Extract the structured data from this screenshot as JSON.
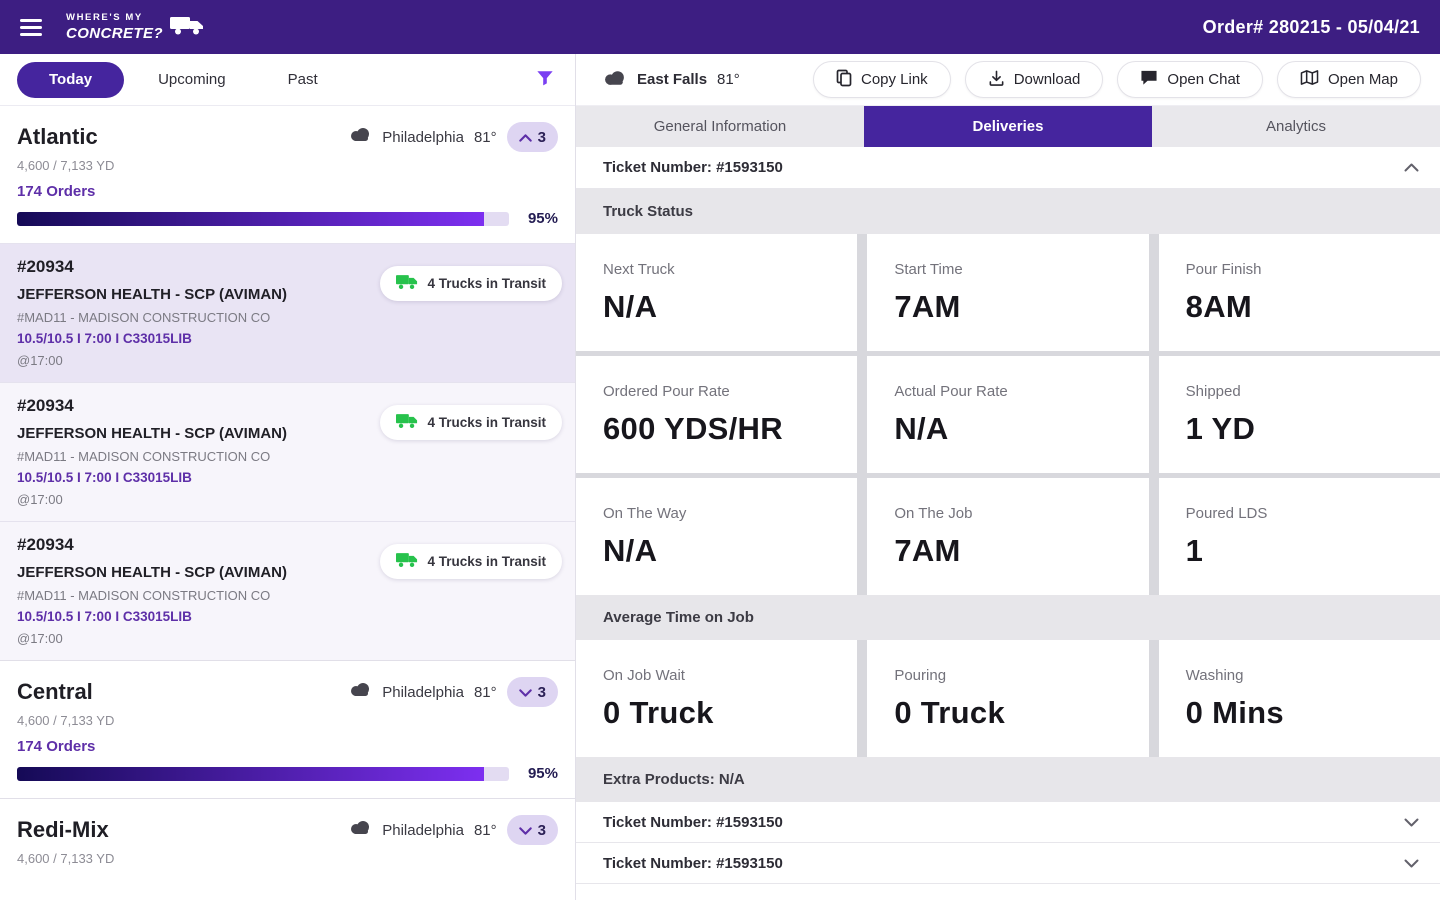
{
  "colors": {
    "header_purple": "#3d1e82",
    "brand_purple": "#45259e",
    "accent_text_purple": "#5e2fa8",
    "progress_gradient_from": "#150a56",
    "progress_gradient_to": "#7d2ff0",
    "count_pill_bg": "#ded5f2",
    "selected_card_bg": "#e9e4f4",
    "truck_green": "#27c24c"
  },
  "header": {
    "brand_line1": "WHERE'S MY",
    "brand_line2": "CONCRETE?",
    "order_info": "Order# 280215 - 05/04/21"
  },
  "left_panel": {
    "tabs": [
      {
        "label": "Today",
        "active": true
      },
      {
        "label": "Upcoming",
        "active": false
      },
      {
        "label": "Past",
        "active": false
      }
    ],
    "groups": [
      {
        "name": "Atlantic",
        "city": "Philadelphia",
        "temp": "81°",
        "badge_count": "3",
        "expanded": true,
        "yards": "4,600 / 7,133 YD",
        "orders_label": "174 Orders",
        "progress_label": "95%",
        "progress_pct": 95
      },
      {
        "name": "Central",
        "city": "Philadelphia",
        "temp": "81°",
        "badge_count": "3",
        "expanded": false,
        "yards": "4,600 / 7,133 YD",
        "orders_label": "174 Orders",
        "progress_label": "95%",
        "progress_pct": 95
      },
      {
        "name": "Redi-Mix",
        "city": "Philadelphia",
        "temp": "81°",
        "badge_count": "3",
        "expanded": false,
        "yards": "4,600 / 7,133 YD"
      }
    ],
    "orders": [
      {
        "id": "#20934",
        "name": "JEFFERSON HEALTH - SCP (AVIMAN)",
        "customer": "#MAD11 - MADISON CONSTRUCTION CO",
        "details": "10.5/10.5 I 7:00 I C33015LIB",
        "time": "@17:00",
        "badge": "4 Trucks in Transit",
        "selected": true
      },
      {
        "id": "#20934",
        "name": "JEFFERSON HEALTH - SCP (AVIMAN)",
        "customer": "#MAD11 - MADISON CONSTRUCTION CO",
        "details": "10.5/10.5 I 7:00 I C33015LIB",
        "time": "@17:00",
        "badge": "4 Trucks in Transit",
        "selected": false
      },
      {
        "id": "#20934",
        "name": "JEFFERSON HEALTH - SCP (AVIMAN)",
        "customer": "#MAD11 - MADISON CONSTRUCTION CO",
        "details": "10.5/10.5 I 7:00 I C33015LIB",
        "time": "@17:00",
        "badge": "4 Trucks in Transit",
        "selected": false
      }
    ]
  },
  "right_panel": {
    "location": {
      "name": "East Falls",
      "temp": "81°"
    },
    "toolbar": [
      {
        "label": "Copy Link"
      },
      {
        "label": "Download"
      },
      {
        "label": "Open Chat"
      },
      {
        "label": "Open Map"
      }
    ],
    "tabs": [
      {
        "label": "General Information",
        "active": false
      },
      {
        "label": "Deliveries",
        "active": true
      },
      {
        "label": "Analytics",
        "active": false
      }
    ],
    "ticket_header": "Ticket Number: #1593150",
    "sections": {
      "truck_status": {
        "title": "Truck Status",
        "stats": [
          {
            "label": "Next Truck",
            "value": "N/A"
          },
          {
            "label": "Start Time",
            "value": "7AM"
          },
          {
            "label": "Pour Finish",
            "value": "8AM"
          },
          {
            "label": "Ordered Pour Rate",
            "value": "600 YDS/HR"
          },
          {
            "label": "Actual Pour Rate",
            "value": "N/A"
          },
          {
            "label": "Shipped",
            "value": "1 YD"
          },
          {
            "label": "On The Way",
            "value": "N/A"
          },
          {
            "label": "On The Job",
            "value": "7AM"
          },
          {
            "label": "Poured LDS",
            "value": "1"
          }
        ]
      },
      "average_time": {
        "title": "Average Time on Job",
        "stats": [
          {
            "label": "On Job Wait",
            "value": "0 Truck"
          },
          {
            "label": "Pouring",
            "value": "0 Truck"
          },
          {
            "label": "Washing",
            "value": "0 Mins"
          }
        ]
      },
      "extra_products": "Extra Products: N/A"
    },
    "collapsed_tickets": [
      {
        "label": "Ticket Number: #1593150"
      },
      {
        "label": "Ticket Number: #1593150"
      }
    ]
  }
}
